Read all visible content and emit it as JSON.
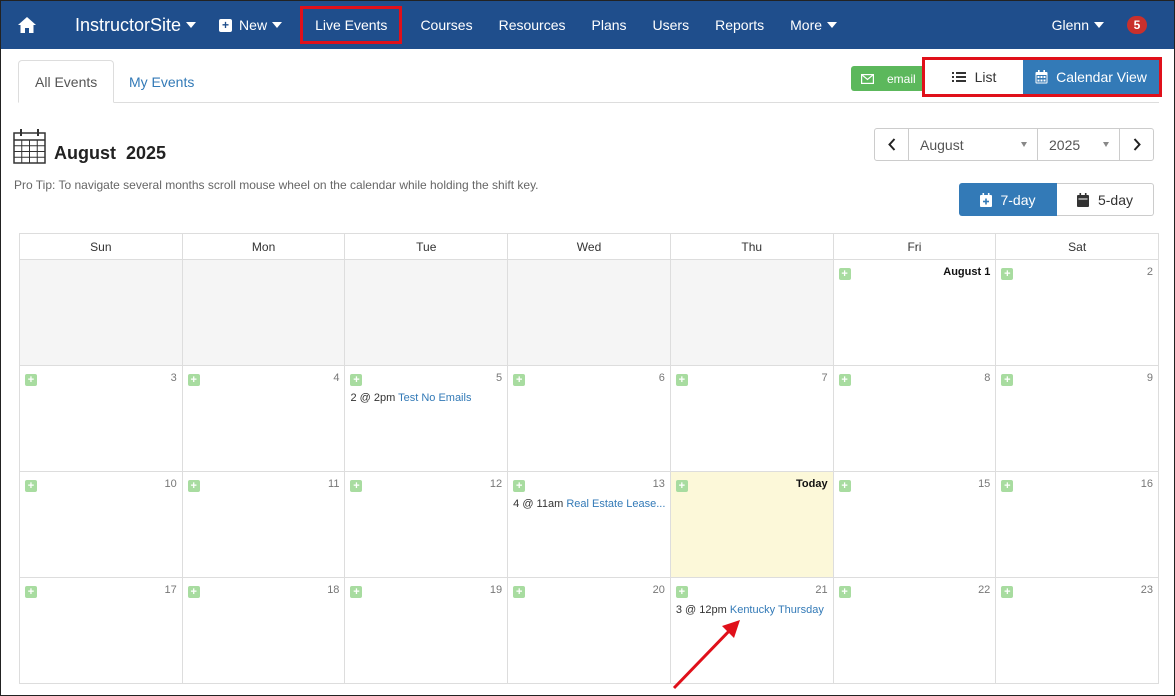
{
  "nav": {
    "brand": "InstructorSite",
    "new": "New",
    "items": [
      "Live Events",
      "Courses",
      "Resources",
      "Plans",
      "Users",
      "Reports",
      "More"
    ],
    "user": "Glenn",
    "notifications": "5",
    "bar_color": "#1f4e8c"
  },
  "tabs": {
    "all": "All Events",
    "mine": "My Events"
  },
  "actions": {
    "email": "email",
    "list": "List",
    "calendar": "Calendar View"
  },
  "header": {
    "month": "August",
    "year": "2025",
    "title_month": "August",
    "title_year": "2025",
    "protip": "Pro Tip: To navigate several months scroll mouse wheel on the calendar while holding the shift key.",
    "seven_day": "7-day",
    "five_day": "5-day"
  },
  "weekdays": [
    "Sun",
    "Mon",
    "Tue",
    "Wed",
    "Thu",
    "Fri",
    "Sat"
  ],
  "weeks": [
    [
      {
        "blank": true
      },
      {
        "blank": true
      },
      {
        "blank": true
      },
      {
        "blank": true
      },
      {
        "blank": true
      },
      {
        "day": "August 1",
        "bold": true
      },
      {
        "day": "2"
      }
    ],
    [
      {
        "day": "3"
      },
      {
        "day": "4"
      },
      {
        "day": "5",
        "event_time": "2 @ 2pm",
        "event_title": "Test No Emails"
      },
      {
        "day": "6"
      },
      {
        "day": "7"
      },
      {
        "day": "8"
      },
      {
        "day": "9"
      }
    ],
    [
      {
        "day": "10"
      },
      {
        "day": "11"
      },
      {
        "day": "12"
      },
      {
        "day": "13",
        "event_time": "4 @ 11am",
        "event_title": "Real Estate Lease..."
      },
      {
        "day": "Today",
        "bold": true,
        "today": true
      },
      {
        "day": "15"
      },
      {
        "day": "16"
      }
    ],
    [
      {
        "day": "17"
      },
      {
        "day": "18"
      },
      {
        "day": "19"
      },
      {
        "day": "20"
      },
      {
        "day": "21",
        "event_time": "3 @ 12pm",
        "event_title": "Kentucky Thursday"
      },
      {
        "day": "22"
      },
      {
        "day": "23"
      }
    ]
  ],
  "colors": {
    "primary": "#337ab7",
    "success": "#5cb85c",
    "highlight": "#e0101a",
    "today": "#fcf8d9"
  }
}
